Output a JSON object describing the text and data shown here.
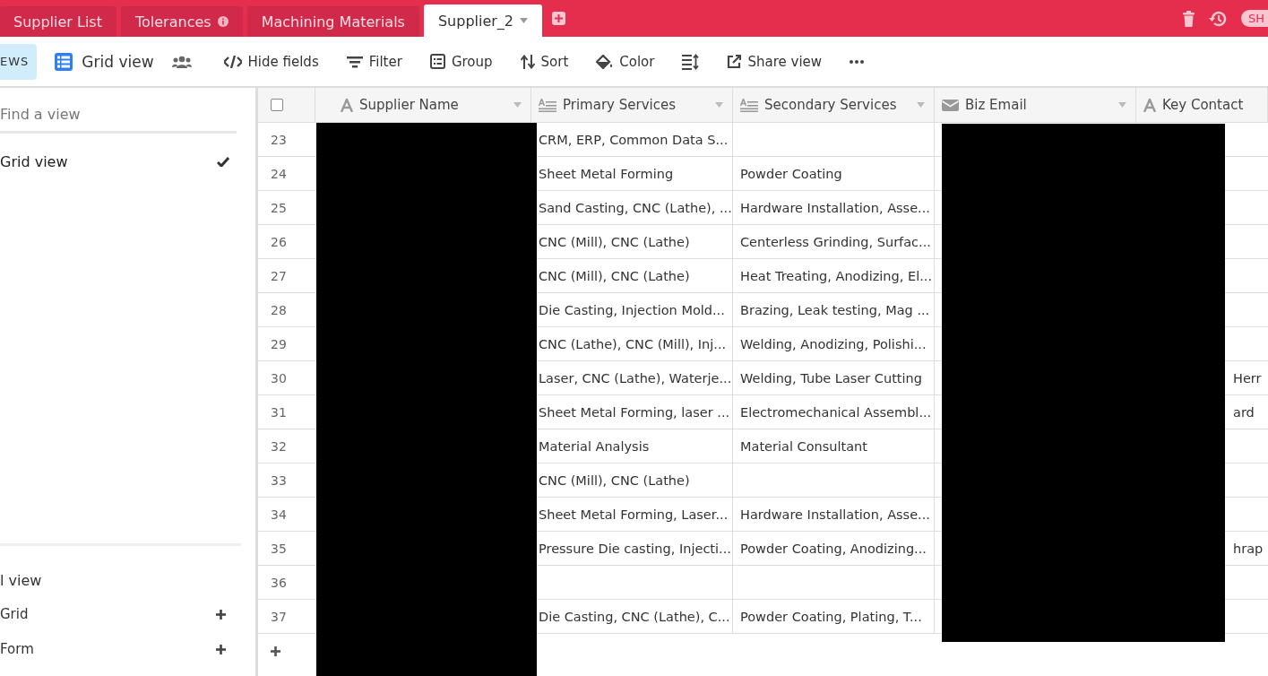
{
  "tabs": [
    {
      "label": "Supplier List",
      "selected": false,
      "info": false
    },
    {
      "label": "Tolerances",
      "selected": false,
      "info": true
    },
    {
      "label": "Machining Materials",
      "selected": false,
      "info": false
    },
    {
      "label": "Supplier_2",
      "selected": true,
      "info": false
    }
  ],
  "account_badge": "SH",
  "toolbar": {
    "views_toggle": {
      "label": "EWS",
      "on": true
    },
    "view_name": "Grid view",
    "tools": [
      {
        "kind": "hide",
        "label": "Hide fields"
      },
      {
        "kind": "filter",
        "label": "Filter"
      },
      {
        "kind": "group",
        "label": "Group"
      },
      {
        "kind": "sort",
        "label": "Sort"
      },
      {
        "kind": "color",
        "label": "Color"
      },
      {
        "kind": "rowheight"
      },
      {
        "kind": "share",
        "label": "Share view"
      },
      {
        "kind": "more"
      }
    ]
  },
  "sidebar": {
    "search": {
      "placeholder": "Find a view"
    },
    "views": [
      {
        "label": "Grid view",
        "selected": true
      }
    ],
    "create": {
      "title": "l view",
      "items": [
        "Grid",
        "Form"
      ]
    }
  },
  "table": {
    "select_all": {
      "checked": false
    },
    "columns": [
      {
        "name": "Supplier Name",
        "kind": "text",
        "menu": true
      },
      {
        "name": "Primary Services",
        "kind": "longtext",
        "menu": true
      },
      {
        "name": "Secondary Services",
        "kind": "longtext",
        "menu": true
      },
      {
        "name": "Biz Email",
        "kind": "email",
        "menu": true
      },
      {
        "name": "Key Contact",
        "kind": "text",
        "menu": false
      }
    ],
    "rows": [
      {
        "number": "23",
        "primary_services": "CRM, ERP, Common Data S..."
      },
      {
        "number": "24",
        "primary_services": "Sheet Metal Forming",
        "secondary_services": "Powder Coating"
      },
      {
        "number": "25",
        "primary_services": "Sand Casting, CNC (Lathe), ...",
        "secondary_services": "Hardware Installation, Asse..."
      },
      {
        "number": "26",
        "primary_services": "CNC (Mill), CNC (Lathe)",
        "secondary_services": "Centerless Grinding, Surfac..."
      },
      {
        "number": "27",
        "primary_services": "CNC (Mill), CNC (Lathe)",
        "secondary_services": "Heat Treating, Anodizing, El..."
      },
      {
        "number": "28",
        "primary_services": "Die Casting, Injection Mold...",
        "secondary_services": "Brazing, Leak testing, Mag ..."
      },
      {
        "number": "29",
        "primary_services": "CNC (Lathe), CNC (Mill), Inj...",
        "secondary_services": "Welding, Anodizing, Polishi..."
      },
      {
        "number": "30",
        "primary_services": "Laser, CNC (Lathe), Waterje...",
        "secondary_services": "Welding, Tube Laser Cutting",
        "key_contact": "Herr"
      },
      {
        "number": "31",
        "primary_services": "Sheet Metal Forming, laser ...",
        "secondary_services": "Electromechanical Assembl...",
        "key_contact": "ard"
      },
      {
        "number": "32",
        "primary_services": "Material Analysis",
        "secondary_services": "Material Consultant"
      },
      {
        "number": "33",
        "primary_services": "CNC (Mill), CNC (Lathe)"
      },
      {
        "number": "34",
        "primary_services": "Sheet Metal Forming, Laser...",
        "secondary_services": "Hardware Installation, Asse..."
      },
      {
        "number": "35",
        "primary_services": "Pressure Die casting, Injecti...",
        "secondary_services": "Powder Coating, Anodizing...",
        "key_contact": "hrap"
      },
      {
        "number": "36"
      },
      {
        "number": "37",
        "primary_services": "Die Casting, CNC (Lathe), C...",
        "secondary_services": "Powder Coating, Plating, T..."
      }
    ]
  }
}
